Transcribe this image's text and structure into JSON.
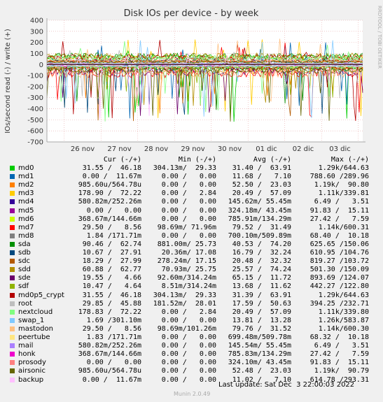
{
  "chart_data": {
    "type": "line",
    "title": "Disk IOs per device - by week",
    "ylabel": "IOs/second read (-) / write (+)",
    "side_label": "RRDTOOL / TOBI OETIKER",
    "ylim": [
      -700,
      400
    ],
    "y_ticks": [
      "400",
      "300",
      "200",
      "100",
      "0",
      "-100",
      "-200",
      "-300",
      "-400",
      "-500",
      "-600",
      "-700"
    ],
    "x_ticks": [
      "26 nov",
      "27 nov",
      "28 nov",
      "29 nov",
      "30 nov",
      "01 dic",
      "02 dic",
      "03 dic"
    ],
    "grid": true,
    "columns": [
      "Cur (-/+)",
      "Min (-/+)",
      "Avg (-/+)",
      "Max (-/+)"
    ],
    "series": [
      {
        "name": "md0",
        "color": "#00cc00",
        "cur": "31.55 /  46.18",
        "min": "304.13m/  29.33",
        "avg": "31.40 /  63.91",
        "max": "1.29k/644.63"
      },
      {
        "name": "md1",
        "color": "#0066b3",
        "cur": "0.00 /  11.67m",
        "min": "0.00 /   0.00",
        "avg": "11.68 /   7.10",
        "max": "788.60 /289.96"
      },
      {
        "name": "md2",
        "color": "#ff8000",
        "cur": "985.60u/564.78u",
        "min": "0.00 /   0.00",
        "avg": "52.50 /  23.03",
        "max": "1.19k/  90.80"
      },
      {
        "name": "md3",
        "color": "#ffcc00",
        "cur": "178.90 /  72.22",
        "min": "0.00 /   2.84",
        "avg": "20.49 /  57.09",
        "max": "1.11k/339.81"
      },
      {
        "name": "md4",
        "color": "#330099",
        "cur": "580.82m/252.26m",
        "min": "0.00 /   0.00",
        "avg": "145.62m/ 55.45m",
        "max": "6.49 /   3.51"
      },
      {
        "name": "md5",
        "color": "#990099",
        "cur": "0.00 /   0.00",
        "min": "0.00 /   0.00",
        "avg": "324.18m/ 43.45m",
        "max": "91.83 /  15.11"
      },
      {
        "name": "md6",
        "color": "#ccff00",
        "cur": "368.67m/144.66m",
        "min": "0.00 /   0.00",
        "avg": "785.91m/134.29m",
        "max": "27.42 /   7.59"
      },
      {
        "name": "md7",
        "color": "#ff0000",
        "cur": "29.50 /   8.56",
        "min": "98.69m/ 71.96m",
        "avg": "79.52 /  31.49",
        "max": "1.14k/600.31"
      },
      {
        "name": "md8",
        "color": "#808080",
        "cur": "1.84 /171.71m",
        "min": "0.00 /   0.00",
        "avg": "700.10m/509.89m",
        "max": "68.40 /  10.18"
      },
      {
        "name": "sda",
        "color": "#008f00",
        "cur": "90.46 /  62.74",
        "min": "881.00m/ 25.73",
        "avg": "40.53 /  74.20",
        "max": "625.65 /150.06"
      },
      {
        "name": "sdb",
        "color": "#00487d",
        "cur": "10.67 /  27.91",
        "min": "20.36m/ 17.08",
        "avg": "16.79 /  32.24",
        "max": "610.95 /104.76"
      },
      {
        "name": "sdc",
        "color": "#b35a00",
        "cur": "18.29 /  27.99",
        "min": "278.24m/ 17.15",
        "avg": "20.48 /  32.32",
        "max": "819.27 /103.72"
      },
      {
        "name": "sdd",
        "color": "#b38f00",
        "cur": "60.88 /  62.77",
        "min": "70.93m/ 25.75",
        "avg": "25.57 /  74.24",
        "max": "501.30 /150.09"
      },
      {
        "name": "sde",
        "color": "#6b006b",
        "cur": "19.55 /   4.66",
        "min": "92.60m/314.24m",
        "avg": "65.15 /  11.72",
        "max": "893.69 /124.07"
      },
      {
        "name": "sdf",
        "color": "#8fb300",
        "cur": "10.47 /   4.64",
        "min": "8.51m/314.24m",
        "avg": "13.68 /  11.62",
        "max": "442.27 /122.80"
      },
      {
        "name": "md0p5_crypt",
        "color": "#b30000",
        "cur": "31.55 /  46.18",
        "min": "304.13m/  29.33",
        "avg": "31.39 /  63.91",
        "max": "1.29k/644.63"
      },
      {
        "name": "root",
        "color": "#bebebe",
        "cur": "29.85 /  45.88",
        "min": "181.52m/  28.01",
        "avg": "17.59 /  50.63",
        "max": "394.25 /232.71"
      },
      {
        "name": "nextcloud",
        "color": "#80ff80",
        "cur": "178.83 /  72.22",
        "min": "0.00 /   2.84",
        "avg": "20.49 /  57.09",
        "max": "1.11k/339.80"
      },
      {
        "name": "swap_1",
        "color": "#80c9ff",
        "cur": "1.69 /301.10m",
        "min": "0.00 /   0.00",
        "avg": "13.81 /  13.28",
        "max": "1.26k/583.87"
      },
      {
        "name": "mastodon",
        "color": "#ffc080",
        "cur": "29.50 /   8.56",
        "min": "98.69m/101.26m",
        "avg": "79.76 /  31.52",
        "max": "1.14k/600.30"
      },
      {
        "name": "peertube",
        "color": "#ffe680",
        "cur": "1.83 /171.71m",
        "min": "0.00 /   0.00",
        "avg": "699.48m/509.78m",
        "max": "68.32 /  10.18"
      },
      {
        "name": "mail",
        "color": "#aa80ff",
        "cur": "580.82m/252.26m",
        "min": "0.00 /   0.00",
        "avg": "145.54m/ 55.45m",
        "max": "6.49 /   3.51"
      },
      {
        "name": "honk",
        "color": "#ee00cc",
        "cur": "368.67m/144.66m",
        "min": "0.00 /   0.00",
        "avg": "785.83m/134.29m",
        "max": "27.42 /   7.59"
      },
      {
        "name": "prosody",
        "color": "#ff8080",
        "cur": "0.00 /   0.00",
        "min": "0.00 /   0.00",
        "avg": "324.10m/ 43.45m",
        "max": "91.83 /  15.11"
      },
      {
        "name": "airsonic",
        "color": "#666600",
        "cur": "985.60u/564.78u",
        "min": "0.00 /   0.00",
        "avg": "52.48 /  23.03",
        "max": "1.19k/  90.79"
      },
      {
        "name": "backup",
        "color": "#ffbfff",
        "cur": "0.00 /  11.67m",
        "min": "0.00 /   0.00",
        "avg": "11.02 /   7.10",
        "max": "614.78 /293.31"
      }
    ]
  },
  "footer": {
    "last_update": "Last update: Sat Dec  3 22:00:03 2022",
    "munin": "Munin 2.0.49"
  }
}
